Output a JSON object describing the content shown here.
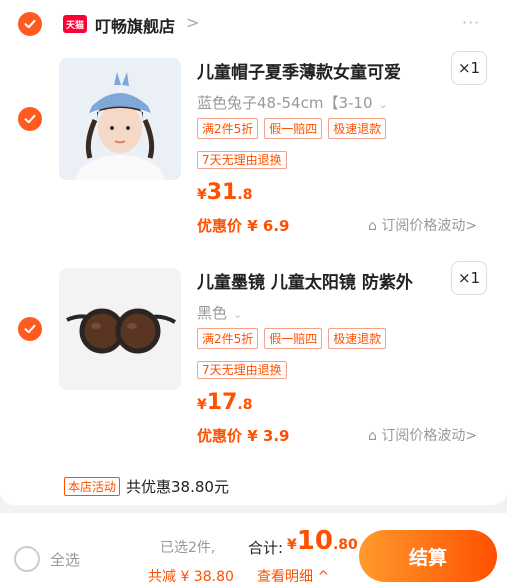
{
  "colors": {
    "accent": "#ff5000",
    "tmall_red": "#ff0036",
    "check": "#ff5a1f"
  },
  "store": {
    "badge": "天猫",
    "name": "叮畅旗舰店",
    "arrow": ">",
    "more": "···"
  },
  "items": [
    {
      "title": "儿童帽子夏季薄款女童可爱",
      "qty": "×1",
      "spec": "蓝色兔子48-54cm【3-10",
      "tags": [
        "满2件5折",
        "假一赔四",
        "极速退款"
      ],
      "tag2": "7天无理由退换",
      "price": {
        "symbol": "¥",
        "int": "31",
        "dec": ".8"
      },
      "discount": "优惠价 ¥ 6.9",
      "subscribe": "订阅价格波动>",
      "image": "kid-with-blue-hat"
    },
    {
      "title": "儿童墨镜 儿童太阳镜 防紫外",
      "qty": "×1",
      "spec": "黑色",
      "tags": [
        "满2件5折",
        "假一赔四",
        "极速退款"
      ],
      "tag2": "7天无理由退换",
      "price": {
        "symbol": "¥",
        "int": "17",
        "dec": ".8"
      },
      "discount": "优惠价 ¥ 3.9",
      "subscribe": "订阅价格波动>",
      "image": "kids-sunglasses"
    }
  ],
  "promo": {
    "tag": "本店活动",
    "text": "共优惠38.80元"
  },
  "footer": {
    "select_all": "全选",
    "selected_count": "已选2件,",
    "total_label": "合计:",
    "total": {
      "symbol": "¥",
      "int": "10",
      "dec": ".80"
    },
    "saved": "共减 ¥ 38.80",
    "detail": "查看明细 ^",
    "checkout": "结算"
  }
}
